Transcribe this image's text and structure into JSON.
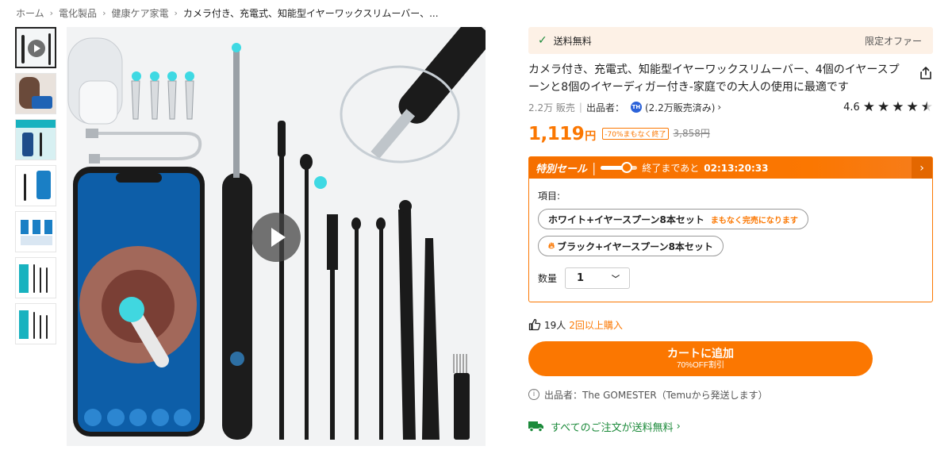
{
  "breadcrumb": {
    "items": [
      "ホーム",
      "電化製品",
      "健康ケア家電",
      "カメラ付き、充電式、知能型イヤーワックスリムーバー、..."
    ],
    "separator": "›"
  },
  "gallery": {
    "thumbnail_count": 7,
    "active_index": 0
  },
  "shipping": {
    "label": "送料無料",
    "limited_offer": "限定オファー"
  },
  "product": {
    "title": "カメラ付き、充電式、知能型イヤーワックスリムーバー、4個のイヤースプーンと8個のイヤーディガー付き-家庭での大人の使用に最適です",
    "sold": "2.2万 販売",
    "seller_label": "出品者：",
    "seller_badge": "TH",
    "seller_sold": "(2.2万販売済み)",
    "rating": "4.6",
    "rating_value": 4.6
  },
  "price": {
    "current": "1,119",
    "currency": "円",
    "discount_tag": "-70%まもなく終了",
    "original": "3,858円"
  },
  "sale": {
    "title": "特別セール",
    "ends_label": "終了まであと",
    "countdown": "02:13:20:33",
    "progress": 0.7
  },
  "options": {
    "label": "項目:",
    "items": [
      {
        "label": "ホワイト+イヤースプーン8本セット",
        "note": "まもなく完売になります"
      },
      {
        "label": "ブラック+イヤースプーン8本セット",
        "note": ""
      }
    ]
  },
  "quantity": {
    "label": "数量",
    "value": "1"
  },
  "social": {
    "likes": "19人",
    "extra": "2回以上購入"
  },
  "cart": {
    "label": "カートに追加",
    "sub": "70%OFF割引"
  },
  "seller_info": "出品者：The GOMESTER（Temuから発送します）",
  "free_shipping": "すべてのご注文が送料無料",
  "colors": {
    "accent": "#fb7701",
    "green": "#1b8a3a"
  }
}
